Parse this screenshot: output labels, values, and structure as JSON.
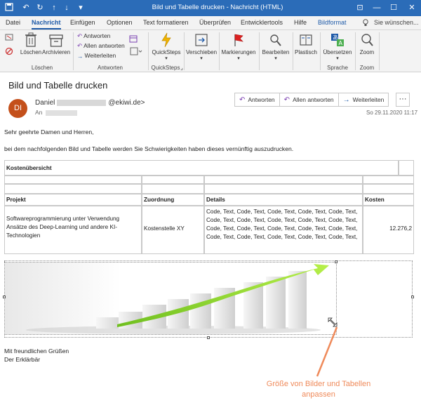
{
  "titlebar": {
    "title": "Bild und Tabelle drucken  -  Nachricht (HTML)",
    "save_icon": "save-icon",
    "undo_icon": "undo-icon",
    "redo_icon": "redo-icon",
    "up_icon": "arrow-up-icon",
    "down_icon": "arrow-down-icon",
    "customize_icon": "customize-icon",
    "minimize": "—",
    "restore": "☐",
    "close": "✕",
    "ribbon_toggle": "⊡"
  },
  "tabs": [
    "Datei",
    "Nachricht",
    "Einfügen",
    "Optionen",
    "Text formatieren",
    "Überprüfen",
    "Entwicklertools",
    "Hilfe",
    "Bildformat"
  ],
  "search_hint": "Sie wünschen...",
  "ribbon": {
    "delete_label": "Löschen",
    "archive_label": "Archivieren",
    "reply_label": "Antworten",
    "reply_all_label": "Allen antworten",
    "forward_label": "Weiterleiten",
    "quicksteps_label": "QuickSteps",
    "move_label": "Verschieben",
    "tags_label": "Markierungen",
    "edit_label": "Bearbeiten",
    "immersive_label": "Plastisch",
    "translate_label": "Übersetzen",
    "zoom_label": "Zoom",
    "group_delete": "Löschen",
    "group_respond": "Antworten",
    "group_quicksteps": "QuickSteps",
    "group_language": "Sprache",
    "group_zoom": "Zoom"
  },
  "message": {
    "subject": "Bild und Tabelle drucken",
    "avatar_initials": "DI",
    "sender_first": "Daniel",
    "sender_domain": "@ekiwi.de>",
    "to_label": "An",
    "date": "So 29.11.2020 11:17",
    "reply_btn": "Antworten",
    "reply_all_btn": "Allen antworten",
    "forward_btn": "Weiterleiten",
    "more_btn": "···"
  },
  "body": {
    "greeting": "Sehr geehrte Damen und Herren,",
    "intro": "bei dem nachfolgenden Bild und Tabelle werden Sie Schwierigkeiten haben dieses vernünftig auszudrucken.",
    "closing1": "Mit freundlichen Grüßen",
    "closing2": "Der Erklärbär"
  },
  "table": {
    "title": "Kostenübersicht",
    "headers": [
      "Projekt",
      "Zuordnung",
      "Details",
      "Kosten"
    ],
    "row": {
      "projekt": "Softwareprogrammierung unter Verwendung Ansätze des Deep-Learning und andere KI-Technologien",
      "zuordnung": "Kostenstelle XY",
      "details": "Code, Text, Code, Text, Code, Text, Code, Text, Code, Text, Code, Text, Code, Text, Code, Text, Code, Text, Code, Text, Code, Text, Code, Text, Code, Text, Code, Text, Code, Text, Code, Text, Code, Text, Code, Text, Code, Text, Code, Text,",
      "kosten": "12.276,2"
    }
  },
  "annotation": {
    "line1": "Größe von Bilder und Tabellen",
    "line2": "anpassen"
  }
}
